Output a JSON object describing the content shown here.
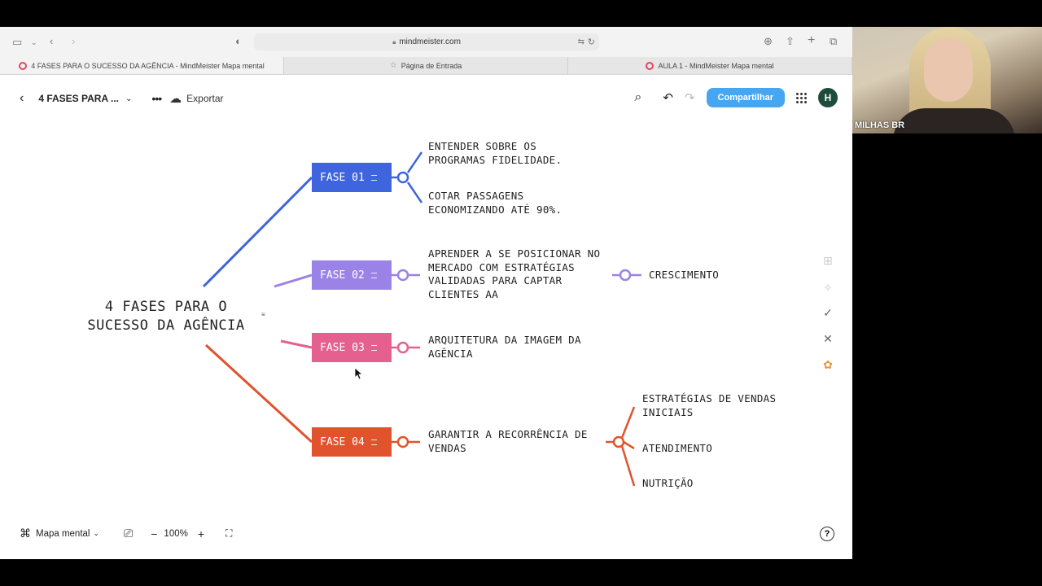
{
  "browser": {
    "url": "mindmeister.com",
    "tabs": [
      {
        "label": "4 FASES PARA O SUCESSO DA AGÊNCIA - MindMeister Mapa mental",
        "active": true
      },
      {
        "label": "Página de Entrada",
        "active": false
      },
      {
        "label": "AULA 1 - MindMeister Mapa mental",
        "active": false
      }
    ]
  },
  "toolbar": {
    "doc_title": "4 FASES PARA ...",
    "export_label": "Exportar",
    "share_label": "Compartilhar",
    "avatar_initial": "H"
  },
  "mindmap": {
    "root": "4 FASES PARA O SUCESSO DA AGÊNCIA",
    "phases": [
      {
        "label": "FASE 01",
        "color": "#3e64de",
        "children": [
          "ENTENDER SOBRE OS PROGRAMAS FIDELIDADE.",
          "COTAR PASSAGENS ECONOMIZANDO ATÉ 90%."
        ]
      },
      {
        "label": "FASE 02",
        "color": "#9b82e6",
        "children": [
          "APRENDER A SE POSICIONAR NO MERCADO COM ESTRATÉGIAS VALIDADAS PARA CAPTAR CLIENTES AA"
        ],
        "grandchildren": [
          "CRESCIMENTO"
        ]
      },
      {
        "label": "FASE 03",
        "color": "#e4608e",
        "children": [
          "ARQUITETURA DA IMAGEM DA AGÊNCIA"
        ]
      },
      {
        "label": "FASE 04",
        "color": "#e0532d",
        "children": [
          "GARANTIR A RECORRÊNCIA DE VENDAS"
        ],
        "grandchildren": [
          "ESTRATÉGIAS DE VENDAS INICIAIS",
          "ATENDIMENTO",
          "NUTRIÇÃO"
        ]
      }
    ]
  },
  "bottombar": {
    "view_mode": "Mapa mental",
    "zoom": "100%"
  },
  "webcam": {
    "name": "MILHAS BR"
  }
}
